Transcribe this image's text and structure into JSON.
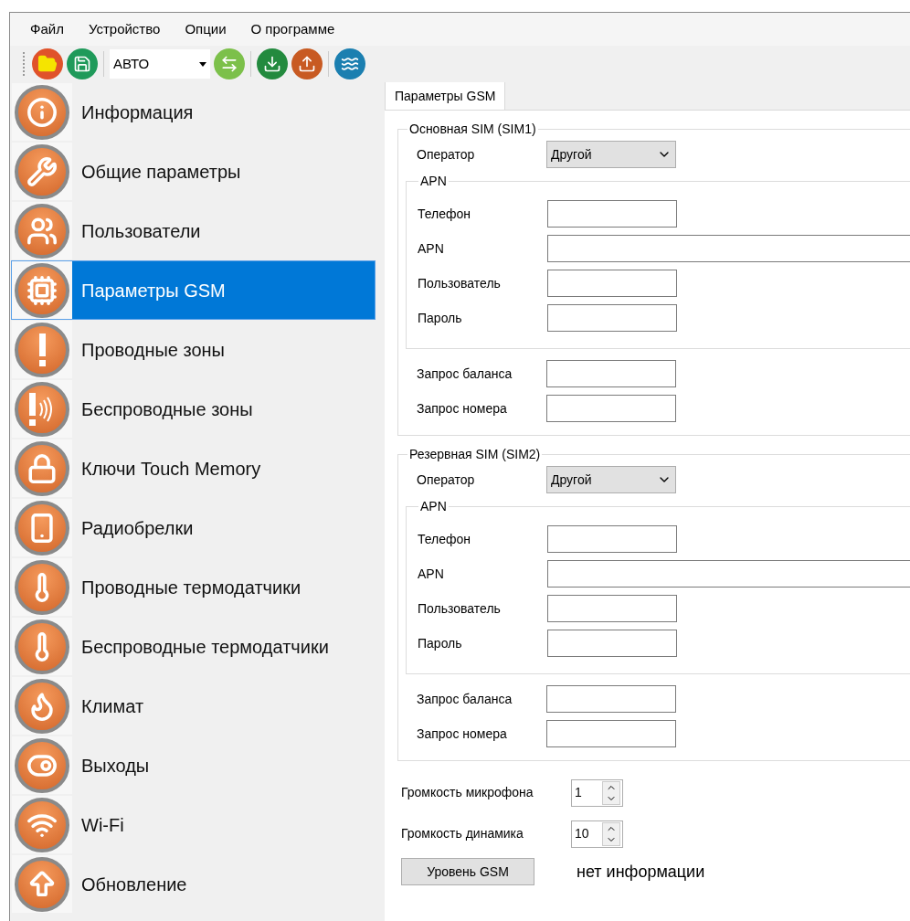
{
  "menu": [
    "Файл",
    "Устройство",
    "Опции",
    "О программе"
  ],
  "toolbar": {
    "mode_select": "АВТО"
  },
  "sidebar": {
    "items": [
      {
        "label": "Информация",
        "selected": false
      },
      {
        "label": "Общие параметры",
        "selected": false
      },
      {
        "label": "Пользователи",
        "selected": false
      },
      {
        "label": "Параметры GSM",
        "selected": true
      },
      {
        "label": "Проводные зоны",
        "selected": false
      },
      {
        "label": "Беспроводные зоны",
        "selected": false
      },
      {
        "label": "Ключи Touch Memory",
        "selected": false
      },
      {
        "label": "Радиобрелки",
        "selected": false
      },
      {
        "label": "Проводные термодатчики",
        "selected": false
      },
      {
        "label": "Беспроводные термодатчики",
        "selected": false
      },
      {
        "label": "Климат",
        "selected": false
      },
      {
        "label": "Выходы",
        "selected": false
      },
      {
        "label": "Wi-Fi",
        "selected": false
      },
      {
        "label": "Обновление",
        "selected": false
      }
    ]
  },
  "tabs": [
    {
      "label": "Параметры GSM",
      "selected": true
    }
  ],
  "sim_groups": [
    {
      "title": "Основная SIM (SIM1)",
      "operator": {
        "label": "Оператор",
        "value": "Другой"
      },
      "apn_group": {
        "title": "APN",
        "fields": [
          {
            "label": "Телефон",
            "kind": "short"
          },
          {
            "label": "APN",
            "kind": "wide"
          },
          {
            "label": "Пользователь",
            "kind": "short"
          },
          {
            "label": "Пароль",
            "kind": "short"
          }
        ]
      },
      "fields": [
        {
          "label": "Запрос баланса"
        },
        {
          "label": "Запрос номера"
        }
      ]
    },
    {
      "title": "Резервная SIM (SIM2)",
      "operator": {
        "label": "Оператор",
        "value": "Другой"
      },
      "apn_group": {
        "title": "APN",
        "fields": [
          {
            "label": "Телефон",
            "kind": "short"
          },
          {
            "label": "APN",
            "kind": "wide"
          },
          {
            "label": "Пользователь",
            "kind": "short"
          },
          {
            "label": "Пароль",
            "kind": "short"
          }
        ]
      },
      "fields": [
        {
          "label": "Запрос баланса"
        },
        {
          "label": "Запрос номера"
        }
      ]
    }
  ],
  "volumes": [
    {
      "label": "Громкость микрофона",
      "value": "1"
    },
    {
      "label": "Громкость динамика",
      "value": "10"
    }
  ],
  "gsm_level": {
    "button": "Уровень GSM",
    "status": "нет информации"
  }
}
